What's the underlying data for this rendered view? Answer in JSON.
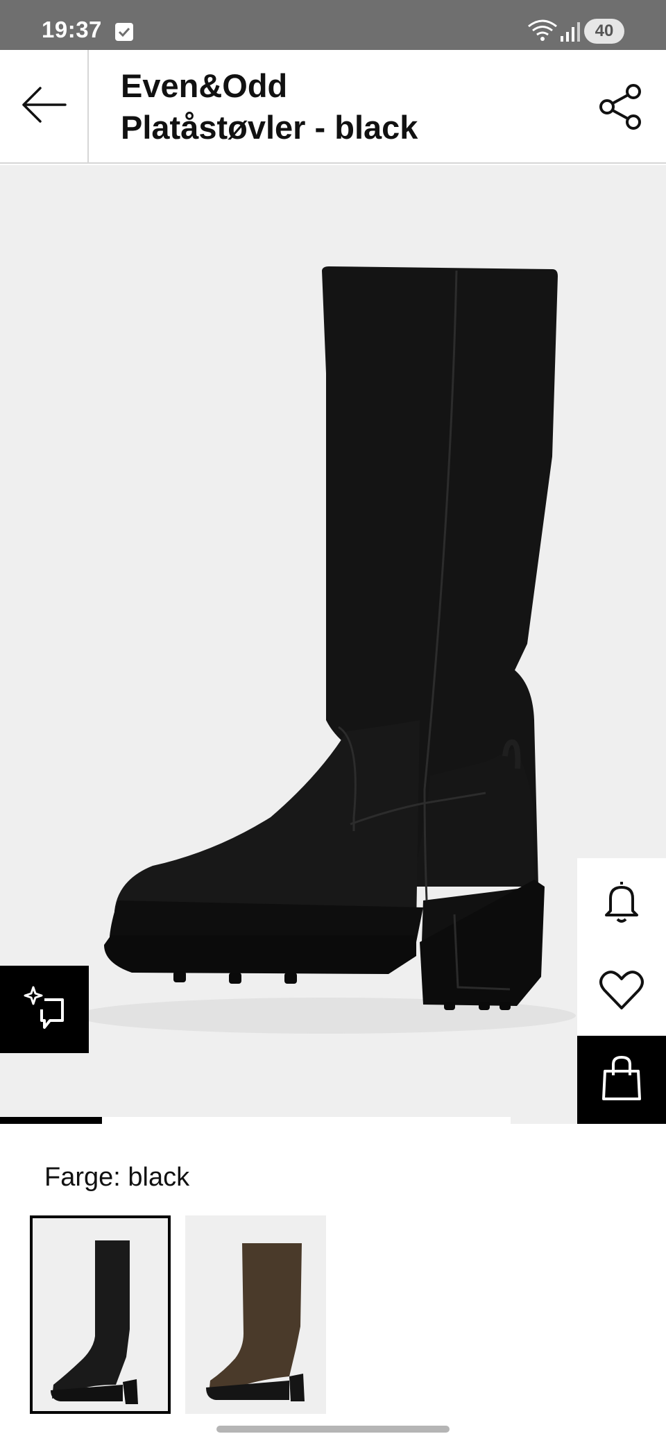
{
  "status_bar": {
    "time": "19:37",
    "battery": "40",
    "icons": [
      "check-notification-icon",
      "wifi-6e-icon",
      "signal-icon",
      "battery-icon"
    ]
  },
  "header": {
    "brand": "Even&Odd",
    "product_name": "Platåstøvler - black",
    "back_icon": "arrow-left-icon",
    "share_icon": "share-icon"
  },
  "gallery": {
    "image_alt": "Black knee-high platform boot with block heel",
    "image_position": 1,
    "progress_fraction": 0.2
  },
  "actions": {
    "ai_icon": "sparkle-chat-icon",
    "notify_icon": "bell-icon",
    "wishlist_icon": "heart-icon",
    "bag_icon": "shopping-bag-icon"
  },
  "color": {
    "label": "Farge: black",
    "options": [
      {
        "name": "black",
        "selected": true,
        "color": "#1a1a1a"
      },
      {
        "name": "brown",
        "selected": false,
        "color": "#4a3a2a"
      }
    ]
  },
  "colors": {
    "status_bar": "#6f6f6f",
    "gallery_bg": "#efefef",
    "accent": "#000000"
  }
}
